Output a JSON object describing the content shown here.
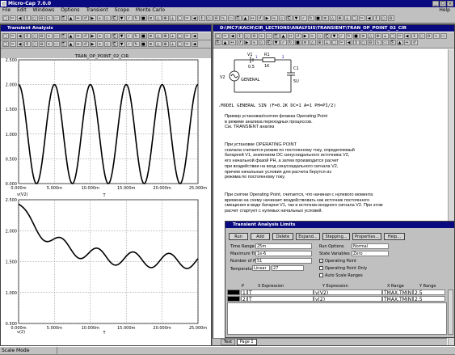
{
  "app": {
    "title": "Micro-Cap 7.0.0",
    "help_label": "Help"
  },
  "menu": [
    "File",
    "Edit",
    "Windows",
    "Options",
    "Transient",
    "Scope",
    "Monte Carlo"
  ],
  "transient_window": {
    "title": "Transient Analysis"
  },
  "plot_top": {
    "title": "TRAN_OP_POINT_02_CIR",
    "y_ticks": [
      "2.500",
      "2.000",
      "1.500",
      "1.000",
      "0.500",
      "0.000"
    ],
    "x_ticks": [
      "0.000m",
      "5.000m",
      "10.000m",
      "15.000m",
      "20.000m",
      "25.000m"
    ],
    "trace_label": "v(V2)",
    "xlabel": "T"
  },
  "plot_bottom": {
    "y_ticks": [
      "2.500",
      "2.000",
      "1.500",
      "1.000",
      "0.500"
    ],
    "x_ticks": [
      "0.000m",
      "5.000m",
      "10.000m",
      "15.000m",
      "20.000m",
      "25.000m"
    ],
    "trace_label": "v(2)",
    "xlabel": "T"
  },
  "chart_data": [
    {
      "type": "line",
      "title": "TRAN_OP_POINT_02_CIR",
      "xlabel": "T",
      "ylabel": "v(V2)",
      "xlim": [
        0,
        25
      ],
      "ylim": [
        0,
        2.5
      ],
      "series": [
        {
          "name": "v(V2)",
          "x_unit": "ms",
          "formula": "1 + sin(2*pi*0.2k*t + pi/2)",
          "amplitude": 1,
          "offset": 1,
          "freq_hz": 200
        }
      ]
    },
    {
      "type": "line",
      "title": "",
      "xlabel": "T",
      "ylabel": "v(2)",
      "xlim": [
        0,
        25
      ],
      "ylim": [
        0.5,
        2.5
      ],
      "series": [
        {
          "name": "v(2)",
          "x_unit": "ms",
          "start_value": 2.4,
          "settled_mean": 1.5,
          "settled_amplitude": 0.12,
          "freq_hz": 200
        }
      ]
    }
  ],
  "circuit_window": {
    "title": "D:\\MC7\\KACH\\CIR_LECTIONS\\ANALYSIS\\TRANSIENT\\TRAN_OP_POINT_02_CIR",
    "components": {
      "v1": "V1",
      "v1_val": "0.5",
      "r1": "R1",
      "r1_val": "1K",
      "c1": "C1",
      "c1_val": "5U",
      "v2": "V2",
      "general": "GENERAL",
      "node1": "1",
      "node2": "2"
    },
    "model_line": ".MODEL GENERAL SIN (F=0.2K DC=1 A=1 PH=PI/2)",
    "para1": [
      "Пример установки/снятия флажка Operating Point",
      "в режиме анализа переходных процессов.",
      "См. TRANSIENT анализ"
    ],
    "para2": [
      "При установке OPERATING POINT",
      "сначала считается режим по постоянному току, определяемый",
      "батареей V1, значением DC синусоидального источника V2,",
      "его начальной фазой PH,  а затем производится расчет",
      "при воздействии на вход синусоидального сигнала V2,",
      "причем начальные условия для расчета берутся из",
      "режима по постоянному току."
    ],
    "para3": [
      "При снятии Operating Point, считается, что начиная с нулевого момента",
      "времени на схему начинает воздействовать как источник постоянного",
      "смещения в виде батареи V1, так и источник входного сигнала V2. При этом",
      "расчет стартует с нулевых начальных условий."
    ]
  },
  "dialog": {
    "title": "Transient Analysis Limits",
    "buttons": [
      "Run",
      "Add",
      "Delete",
      "Expand...",
      "Stepping...",
      "Properties...",
      "Help..."
    ],
    "time_range_label": "Time Range",
    "time_range": "25m",
    "max_step_label": "Maximum Time Step",
    "max_step": "1e-6",
    "num_points_label": "Number of Points",
    "num_points": "51",
    "temperature_label": "Temperature",
    "temperature_mode": "Linear",
    "temperature": "27",
    "run_options_label": "Run Options",
    "run_options": "Normal",
    "state_vars_label": "State Variables",
    "state_vars": "Zero",
    "op_point_label": "Operating Point",
    "op_point_only_label": "Operating Point Only",
    "auto_scale_label": "Auto Scale Ranges",
    "grid_headers": {
      "p": "P",
      "x_expr": "X Expression",
      "y_expr": "Y Expression",
      "x_range": "X Range",
      "y_range": "Y Range"
    },
    "rows": [
      {
        "p": "1",
        "x": "T",
        "y": "v(V2)",
        "xr": "TMAX,TMIN",
        "yr": "2.5"
      },
      {
        "p": "2",
        "x": "T",
        "y": "v(2)",
        "xr": "TMAX,TMIN",
        "yr": "2.5"
      }
    ]
  },
  "tabs": [
    "Text",
    "Page 1"
  ],
  "status": {
    "mode": "Scale Mode"
  }
}
